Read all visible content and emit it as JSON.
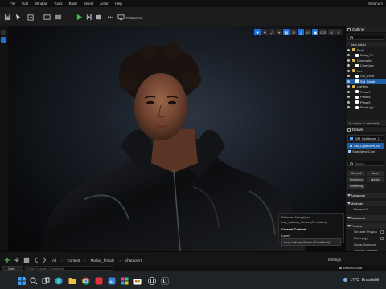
{
  "menubar": {
    "items": [
      "File",
      "Edit",
      "Window",
      "Tools",
      "Build",
      "Select",
      "Actor",
      "Help"
    ],
    "app_title": "Metahum"
  },
  "toolbar": {
    "platforms_label": "Platforms"
  },
  "viewport": {
    "buttons": [
      "✚",
      "⟲",
      "⤢",
      "⌖",
      "▦",
      "10",
      "△",
      "10°",
      "▣",
      "0.25",
      "◎",
      "4"
    ],
    "selected_panel": {
      "title": "Selected Actor(s) in",
      "subtitle": "Lvs_Yadnas_Scene (Persistent)",
      "current_context": "Current Context",
      "level_label": "Level",
      "level_value": "Lvs_Yadnas_Scene (Persistent)"
    }
  },
  "outliner": {
    "title": "Outliner",
    "column_header": "Item Label",
    "rows": [
      {
        "label": "Body",
        "icon_color": "#d6b24a"
      },
      {
        "label": "Body_Fa",
        "icon_color": "#ffffff"
      },
      {
        "label": "Cinematic",
        "icon_color": "#d6b24a"
      },
      {
        "label": "CineCam",
        "icon_color": "#ffffff"
      },
      {
        "label": "Lev",
        "icon_color": "#d6b24a"
      },
      {
        "label": "SM_Enve",
        "icon_color": "#ffffff"
      },
      {
        "label": "SM_Lightr",
        "icon_color": "#ffffff"
      },
      {
        "label": "Lighting",
        "icon_color": "#d6b24a"
      },
      {
        "label": "Plane1",
        "icon_color": "#ffffff"
      },
      {
        "label": "Plane6",
        "icon_color": "#ffffff"
      },
      {
        "label": "Plane5",
        "icon_color": "#ffffff"
      },
      {
        "label": "PointLigh",
        "icon_color": "#ffffff"
      }
    ],
    "footer": "16 actors (1 selected)"
  },
  "details": {
    "title": "Details",
    "actor_name": "SM_Lightroom_f",
    "component_selected": "SM_Lightroom_Bo",
    "component_sub": "StaticMeshCom",
    "search_placeholder": "Search",
    "tabs": [
      "General",
      "Actor",
      "Rendering",
      "Lighting",
      "Streaming",
      ""
    ],
    "sections": [
      "Advanced",
      "Materials",
      "Advanced",
      "Physics"
    ],
    "props": [
      "Element 0",
      "Simulate Physics",
      "Mass (kg)",
      "Linear Damping",
      "Angular Damping"
    ]
  },
  "content_browser": {
    "crumbs": [
      "All",
      "Content",
      "Modus_female",
      "character1"
    ],
    "settings_label": "Settings"
  },
  "status": {
    "cmd_label": "Cmd",
    "cmd_placeholder": "Enter Console Command",
    "saved_label": "Derived Data"
  },
  "taskbar": {
    "temperature": "17°C",
    "condition": "Ensoleillé"
  }
}
